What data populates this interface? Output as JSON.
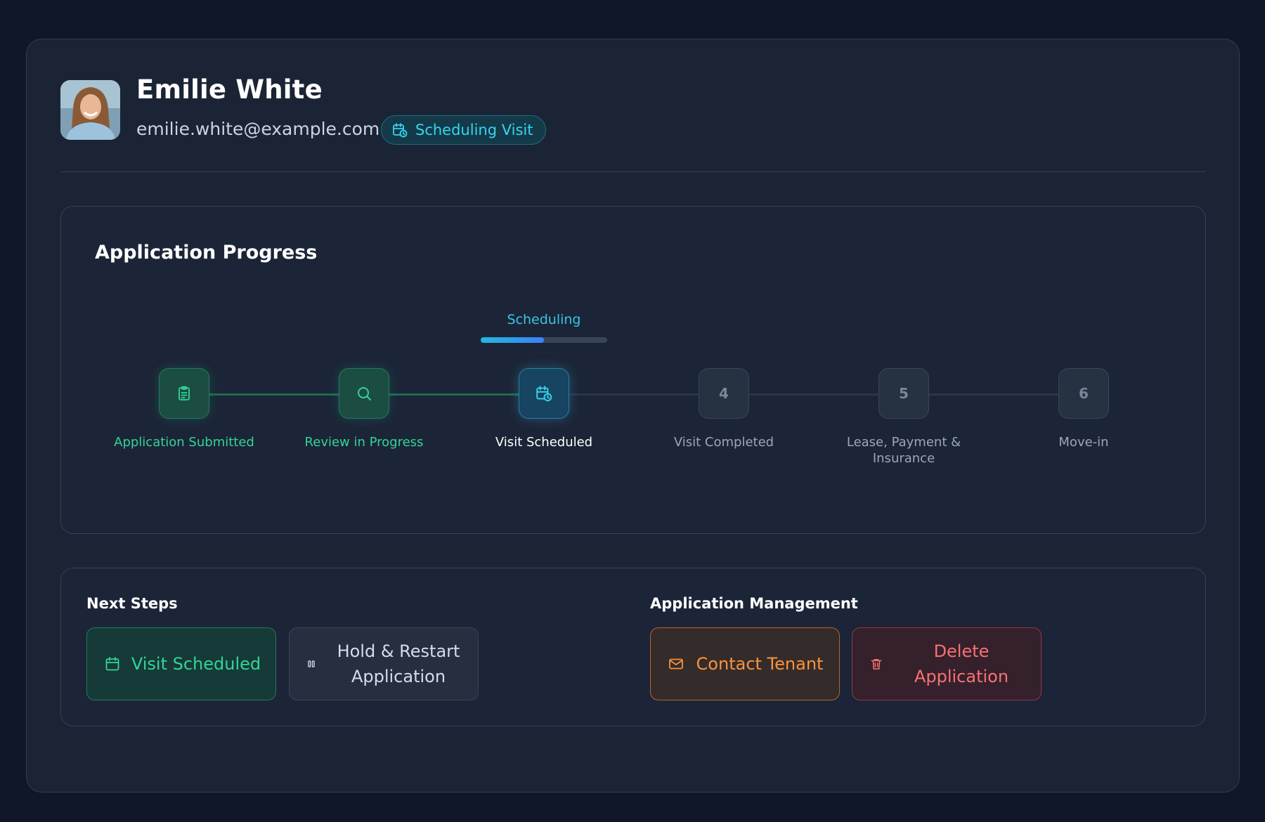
{
  "profile": {
    "name": "Emilie White",
    "email": "emilie.white@example.com",
    "status": "Scheduling Visit"
  },
  "progress": {
    "title": "Application Progress",
    "current_stage_label": "Scheduling",
    "current_stage_progress": 0.5,
    "steps": [
      {
        "label": "Application Submitted",
        "state": "done",
        "icon": "clipboard-icon"
      },
      {
        "label": "Review in Progress",
        "state": "done",
        "icon": "search-icon"
      },
      {
        "label": "Visit Scheduled",
        "state": "current",
        "icon": "calendar-clock-icon"
      },
      {
        "label": "Visit Completed",
        "state": "todo",
        "number": "4"
      },
      {
        "label": "Lease, Payment & Insurance",
        "state": "todo",
        "number": "5"
      },
      {
        "label": "Move-in",
        "state": "todo",
        "number": "6"
      }
    ]
  },
  "next_steps": {
    "title": "Next Steps",
    "visit_scheduled": "Visit Scheduled",
    "hold_restart": "Hold & Restart Application"
  },
  "management": {
    "title": "Application Management",
    "contact_tenant": "Contact Tenant",
    "delete_application": "Delete Application"
  },
  "colors": {
    "accent_cyan": "#38d3ee",
    "success_green": "#34d399",
    "warning_orange": "#fb923c",
    "danger_red": "#f87171"
  }
}
